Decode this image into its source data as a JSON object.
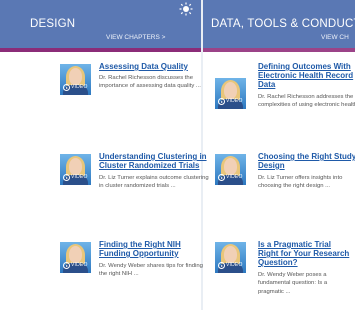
{
  "columns": [
    {
      "title": "DESIGN",
      "link": "VIEW CHAPTERS >",
      "items": [
        {
          "title": "Assessing Data Quality",
          "desc": "Dr. Rachel Richesson discusses the importance of assessing data quality ...",
          "video_label": "VIDEO"
        },
        {
          "title": "Understanding Clustering in Cluster Randomized Trials",
          "desc": "Dr. Liz Turner explains outcome clustering in cluster randomized trials ...",
          "video_label": "VIDEO"
        },
        {
          "title": "Finding the Right NIH Funding Opportunity",
          "desc": "Dr. Wendy Weber shares tips for finding the right NIH ...",
          "video_label": "VIDEO"
        }
      ]
    },
    {
      "title": "DATA, TOOLS & CONDUCT",
      "link": "VIEW CH",
      "items": [
        {
          "title": "Defining Outcomes With Electronic Health Record Data",
          "desc": "Dr. Rachel Richesson addresses the complexities of using electronic health ...",
          "video_label": "VIDEO"
        },
        {
          "title": "Choosing the Right Study Design",
          "desc": "Dr. Liz Turner offers insights into choosing the right design ...",
          "video_label": "VIDEO"
        },
        {
          "title": "Is a Pragmatic Trial Right for Your Research Question?",
          "desc": "Dr. Wendy Weber poses a fundamental question: Is a pragmatic ...",
          "video_label": "VIDEO"
        }
      ]
    }
  ],
  "colors": {
    "header_bg": "#5a78b4",
    "header_accent": "#8b2c78",
    "link": "#1f5aa8"
  }
}
